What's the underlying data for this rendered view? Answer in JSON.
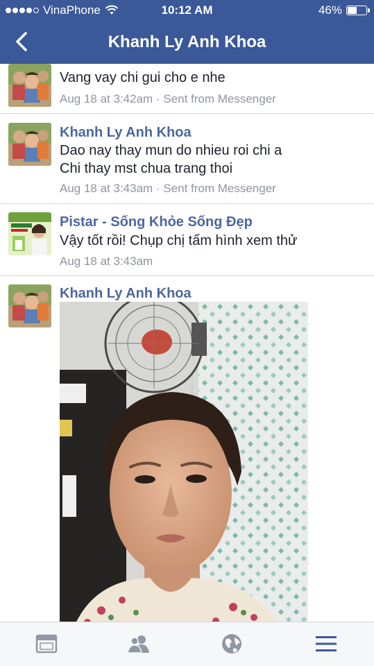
{
  "status_bar": {
    "carrier": "VinaPhone",
    "time": "10:12 AM",
    "battery_percent": "46%",
    "battery_level": 0.46,
    "signal_bars": 4,
    "wifi_icon": "wifi-icon"
  },
  "nav": {
    "title": "Khanh Ly Anh Khoa",
    "back_icon": "chevron-left-icon"
  },
  "messages": [
    {
      "sender": "",
      "lines": [
        "Vang vay chi gui cho e nhe"
      ],
      "meta": "Aug 18 at 3:42am · Sent from Messenger",
      "avatar": "avatar-children"
    },
    {
      "sender": "Khanh Ly Anh Khoa",
      "lines": [
        "Dao nay thay mun do nhieu roi chi a",
        "Chi thay mst chua trang thoi"
      ],
      "meta": "Aug 18 at 3:43am · Sent from Messenger",
      "avatar": "avatar-children"
    },
    {
      "sender": "Pistar - Sống Khỏe Sống Đẹp",
      "lines": [
        "Vậy tốt rồi! Chụp chị tấm hình xem thử"
      ],
      "meta": "Aug 18 at 3:43am",
      "avatar": "avatar-page-brand"
    },
    {
      "sender": "Khanh Ly Anh Khoa",
      "lines": [],
      "meta": "",
      "avatar": "avatar-children",
      "attachment": "selfie-photo"
    }
  ],
  "tab_bar": {
    "items": [
      {
        "icon": "news-feed-icon"
      },
      {
        "icon": "friends-icon"
      },
      {
        "icon": "globe-icon"
      },
      {
        "icon": "menu-icon"
      }
    ]
  },
  "colors": {
    "brand": "#3b5998",
    "link_name": "#4b67a1",
    "meta": "#90949c"
  }
}
